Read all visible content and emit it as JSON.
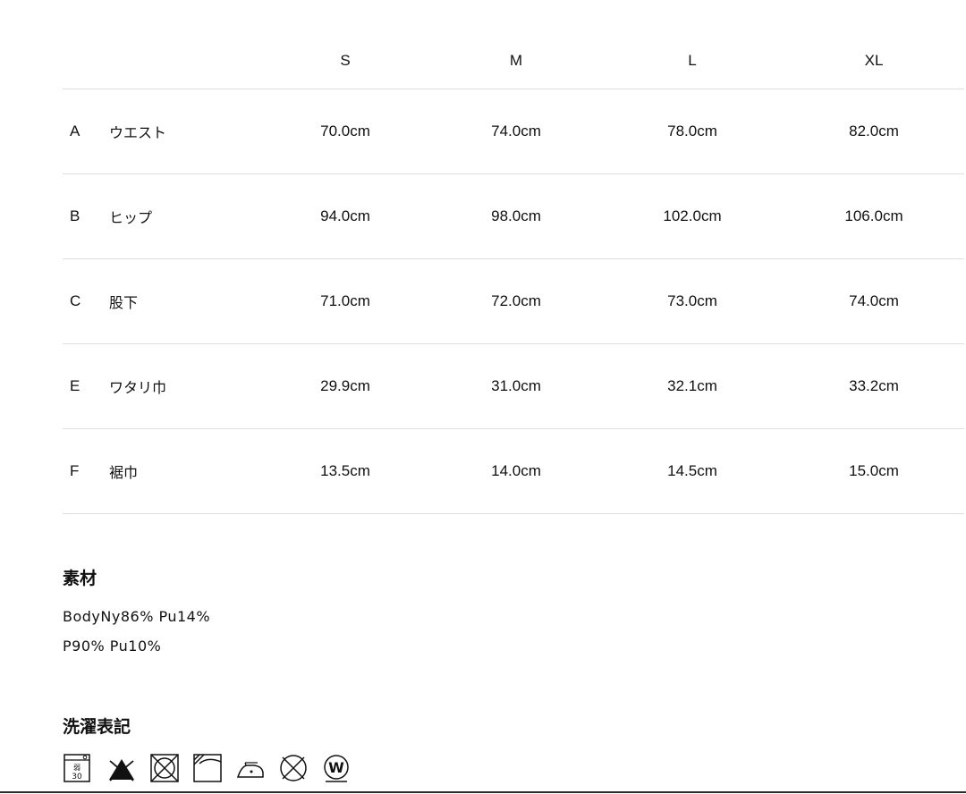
{
  "table": {
    "sizes": [
      "S",
      "M",
      "L",
      "XL"
    ],
    "rows": [
      {
        "code": "A",
        "name": "ウエスト",
        "values": [
          "70.0cm",
          "74.0cm",
          "78.0cm",
          "82.0cm"
        ]
      },
      {
        "code": "B",
        "name": "ヒップ",
        "values": [
          "94.0cm",
          "98.0cm",
          "102.0cm",
          "106.0cm"
        ]
      },
      {
        "code": "C",
        "name": "股下",
        "values": [
          "71.0cm",
          "72.0cm",
          "73.0cm",
          "74.0cm"
        ]
      },
      {
        "code": "E",
        "name": "ワタリ巾",
        "values": [
          "29.9cm",
          "31.0cm",
          "32.1cm",
          "33.2cm"
        ]
      },
      {
        "code": "F",
        "name": "裾巾",
        "values": [
          "13.5cm",
          "14.0cm",
          "14.5cm",
          "15.0cm"
        ]
      }
    ]
  },
  "material": {
    "title": "素材",
    "lines": [
      "BodyNy86% Pu14%",
      "P90% Pu10%"
    ]
  },
  "care": {
    "title": "洗濯表記",
    "wash_label_top": "弱",
    "wash_label_temp": "30",
    "dry_clean_letter": "W",
    "icons": [
      "wash-tub-30-icon",
      "no-bleach-icon",
      "no-tumble-dry-icon",
      "line-dry-shade-icon",
      "low-iron-icon",
      "no-dry-clean-icon",
      "wet-clean-icon"
    ]
  }
}
